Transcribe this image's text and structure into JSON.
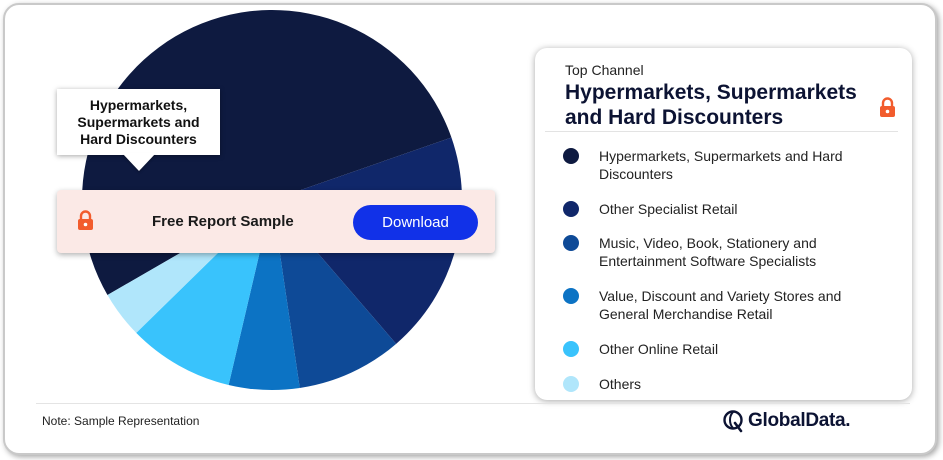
{
  "chart_data": {
    "type": "pie",
    "slices": [
      {
        "label": "Hypermarkets, Supermarkets and Hard Discounters",
        "value": 53,
        "color": "#0e1a40"
      },
      {
        "label": "Other Specialist Retail",
        "value": 19,
        "color": "#10276a"
      },
      {
        "label": "Music, Video, Book, Stationery and Entertainment Software Specialists",
        "value": 9,
        "color": "#0e4a97"
      },
      {
        "label": "Value, Discount and Variety Stores and General Merchandise Retail",
        "value": 6,
        "color": "#0c73c4"
      },
      {
        "label": "Other Online Retail",
        "value": 9,
        "color": "#39c3fc"
      },
      {
        "label": "Others",
        "value": 4,
        "color": "#b0e6fb"
      }
    ]
  },
  "callout": {
    "label": "Hypermarkets, Supermarkets and Hard Discounters"
  },
  "banner": {
    "text": "Free Report Sample",
    "button_label": "Download",
    "lock_icon": "lock-icon"
  },
  "legend": {
    "subtitle": "Top Channel",
    "title": "Hypermarkets, Supermarkets and Hard Discounters",
    "items": [
      {
        "label": "Hypermarkets, Supermarkets and Hard Discounters",
        "color": "#0e1a40"
      },
      {
        "label": "Other Specialist Retail",
        "color": "#10276a"
      },
      {
        "label": "Music, Video, Book, Stationery and Entertainment Software Specialists",
        "color": "#0e4a97"
      },
      {
        "label": "Value, Discount and Variety Stores and General Merchandise Retail",
        "color": "#0c73c4"
      },
      {
        "label": "Other Online Retail",
        "color": "#39c3fc"
      },
      {
        "label": "Others",
        "color": "#b0e6fb"
      }
    ]
  },
  "footer": {
    "note": "Note: Sample Representation",
    "brand": "GlobalData."
  },
  "colors": {
    "accent_lock": "#f25c2d",
    "button": "#1131e8",
    "banner_bg": "#fbe9e6"
  }
}
